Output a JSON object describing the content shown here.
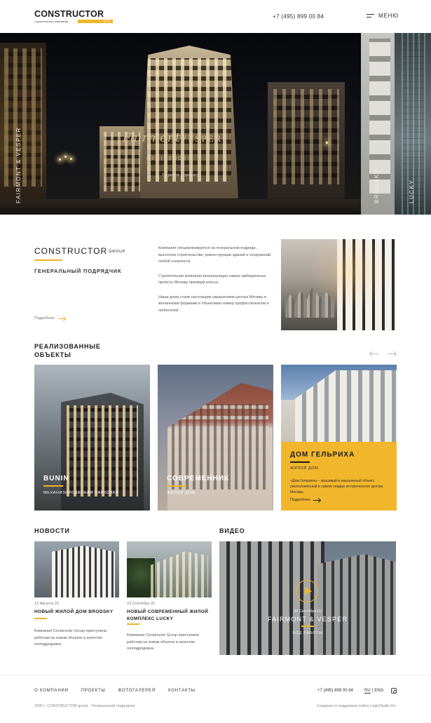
{
  "header": {
    "logo_word": "CONSTRUCTOR",
    "logo_sub": "строительная компания",
    "logo_badge": "group",
    "phone": "+7 (495) 899 00 84",
    "menu_label": "МЕНЮ",
    "menu_icon": "hamburger-icon"
  },
  "hero": {
    "script": "Fairmont",
    "caps": "VESPER",
    "residence": "RESIDENCES",
    "link": "Перейти к проекту",
    "side_left": "FAIRMONT & VESPER",
    "side_brodsky": "BRODSKY",
    "side_lucky": "LUCKY"
  },
  "about": {
    "title": "CONSTRUCTOR",
    "title_small": "GROUP",
    "subtitle": "ГЕНЕРАЛЬНЫЙ ПОДРЯДЧИК",
    "more": "Подробнее",
    "paragraphs": [
      "Компания специализируется на генеральном подряде, высотном строительстве, реконструкции зданий и сооружений любой сложности.",
      "Строительная компания реализующая самые амбициозные проекты Москвы премиум класса.",
      "Наши дома стали настоящим украшением центра Москвы и желанными формами в объективах камер профессионалов и любителей."
    ]
  },
  "realized": {
    "title": "РЕАЛИЗОВАННЫЕ ОБЪЕКТЫ",
    "prev_icon": "arrow-left-icon",
    "next_icon": "arrow-right-icon",
    "cards": [
      {
        "name": "BUNIN",
        "sub": "МЕХАНИЗИРОВАННАЯ ПАРКОВКА"
      },
      {
        "name": "СОВРЕМЕННИК",
        "sub": "ЖИЛОЙ ДОМ"
      },
      {
        "name": "ДОМ ГЕЛЬРИХА",
        "sub": "ЖИЛОЙ ДОМ",
        "text": "«Дом Гельриха» - красивый и изысканный объект, расположенный в самом сердце исторического центра Москвы.",
        "more": "Подробнее"
      }
    ]
  },
  "news": {
    "title": "НОВОСТИ",
    "items": [
      {
        "date": "12 Августа 20",
        "head": "НОВЫЙ ЖИЛОЙ ДОМ BRODSKY",
        "text": "Компания Constructor Group приступила работам на новом объекте в качестве генподрядчика."
      },
      {
        "date": "23 Сентября 20",
        "head": "НОВЫЙ СОВРЕМЕННЫЙ ЖИЛОЙ КОМПЛЕКС LUCKY",
        "text": "Компания Constructor Group приступила работам на новом объекте в качестве генподрядчика."
      }
    ]
  },
  "video": {
    "title": "ВИДЕО",
    "date": "30 Сентября 20",
    "name": "FAIRMONT & VESPER",
    "sub": "ХОД РАБОТЫ",
    "play_icon": "play-icon"
  },
  "footer": {
    "nav": [
      "О КОМПАНИИ",
      "ПРОЕКТЫ",
      "ФОТОГАЛЕРЕЯ",
      "КОНТАКТЫ"
    ],
    "phone": "+7 (495) 899 00 84",
    "lang_ru": "RU",
    "lang_sep": "|",
    "lang_eng": "ENG",
    "insta_icon": "instagram-icon",
    "copy": "2020 г. CONSTRUCTOR group - Генеральный подрядчик",
    "credit": "Создание и поддержка сайта LogicStudio.Ru"
  },
  "colors": {
    "accent": "#f0b429",
    "text": "#1b1b1b"
  }
}
